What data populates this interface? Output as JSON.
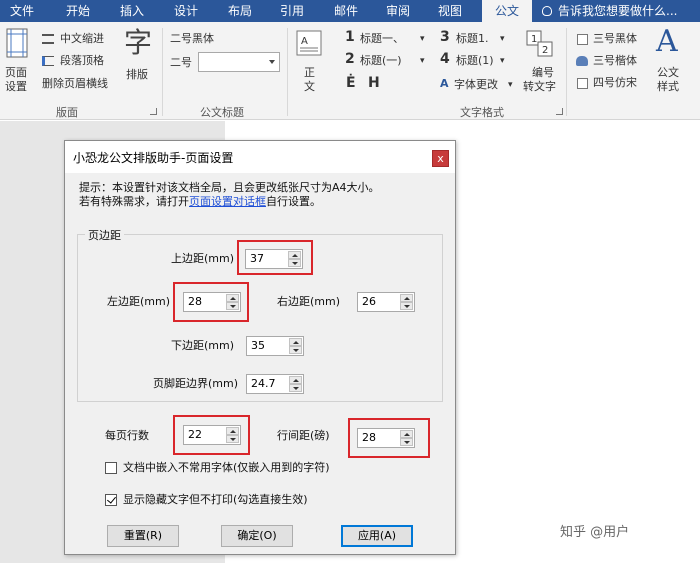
{
  "ribbon_tabs": [
    "文件",
    "开始",
    "插入",
    "设计",
    "布局",
    "引用",
    "邮件",
    "审阅",
    "视图",
    "公文"
  ],
  "active_tab": "公文",
  "tell_me": "告诉我您想要做什么...",
  "ribbon": {
    "page_setup_l1": "页面",
    "page_setup_l2": "设置",
    "chinese_indent": "中文缩进",
    "para_grid": "段落顶格",
    "remove_header_line": "删除页眉横线",
    "typeset_icon_char": "字",
    "typeset": "排版",
    "group_layout": "版面",
    "font_label_top": "二号黑体",
    "size_label": "二号",
    "group_title": "公文标题",
    "body_l1": "正",
    "body_l2": "文",
    "h1_num": "1",
    "h1": "标题一、",
    "h1_dd": "▾",
    "h2_num": "2",
    "h2": "标题(一)",
    "h2_dd": "▾",
    "e_mark": "Ė",
    "h_mark": "H",
    "h3_num": "3",
    "h3": "标题1.",
    "h3_dd": "▾",
    "h4_num": "4",
    "h4": "标题(1)",
    "h4_dd": "▾",
    "font_change": "字体更改",
    "font_change_dd": "▾",
    "group_format": "文字格式",
    "numbering_l1": "编号",
    "numbering_l2": "转文字",
    "font3_hei": "三号黑体",
    "font3_kai": "三号楷体",
    "font4_fs": "四号仿宋",
    "style_icon_char": "A",
    "style_l1": "公文",
    "style_l2": "样式"
  },
  "dialog": {
    "title": "小恐龙公文排版助手-页面设置",
    "close": "x",
    "hint_line1": "提示：本设置针对该文档全局，且会更改纸张尺寸为A4大小。",
    "hint_line2_pre": "若有特殊需求，请打开",
    "hint_link": "页面设置对话框",
    "hint_line2_post": "自行设置。",
    "margins_group": "页边距",
    "top_label": "上边距(mm)",
    "top_value": "37",
    "left_label": "左边距(mm)",
    "left_value": "28",
    "right_label": "右边距(mm)",
    "right_value": "26",
    "bottom_label": "下边距(mm)",
    "bottom_value": "35",
    "footer_label": "页脚距边界(mm)",
    "footer_value": "24.7",
    "lines_label": "每页行数",
    "lines_value": "22",
    "spacing_label": "行间距(磅)",
    "spacing_value": "28",
    "embed_fonts": "文档中嵌入不常用字体(仅嵌入用到的字符)",
    "embed_fonts_checked": false,
    "show_hidden": "显示隐藏文字但不打印(勾选直接生效)",
    "show_hidden_checked": true,
    "reset_btn": "重置(R)",
    "ok_btn": "确定(O)",
    "apply_btn": "应用(A)"
  },
  "watermark": "知乎 @用户"
}
